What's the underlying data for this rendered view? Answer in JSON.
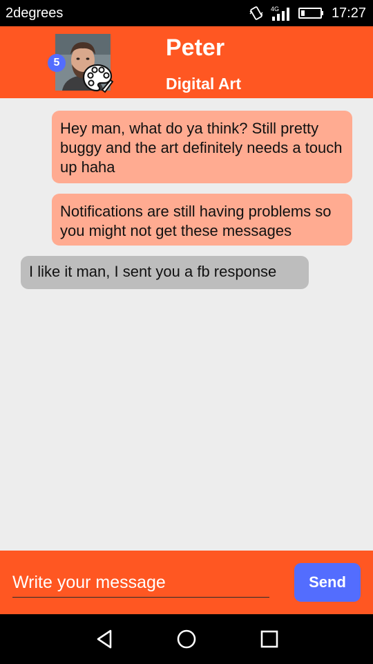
{
  "status_bar": {
    "carrier": "2degrees",
    "network": "4G",
    "time": "17:27"
  },
  "header": {
    "name": "Peter",
    "subtitle": "Digital Art",
    "badge_count": "5",
    "avatar_icon": "user-photo",
    "category_icon": "palette-icon"
  },
  "messages": [
    {
      "direction": "sent",
      "text": "Hey man, what do ya think? Still pretty buggy and the art definitely needs a touch up haha"
    },
    {
      "direction": "sent",
      "text": "Notifications are still having problems so you might not get these messages"
    },
    {
      "direction": "received",
      "text": "I like it man, I sent you a fb response"
    }
  ],
  "composer": {
    "placeholder": "Write your message",
    "value": "",
    "send_label": "Send"
  },
  "nav": {
    "back_icon": "triangle-back-icon",
    "home_icon": "circle-home-icon",
    "recent_icon": "square-recents-icon"
  },
  "colors": {
    "primary": "#ff5722",
    "accent": "#536dfe",
    "sent_bubble": "#ffab91",
    "received_bubble": "#bdbdbd",
    "background": "#ededed"
  }
}
